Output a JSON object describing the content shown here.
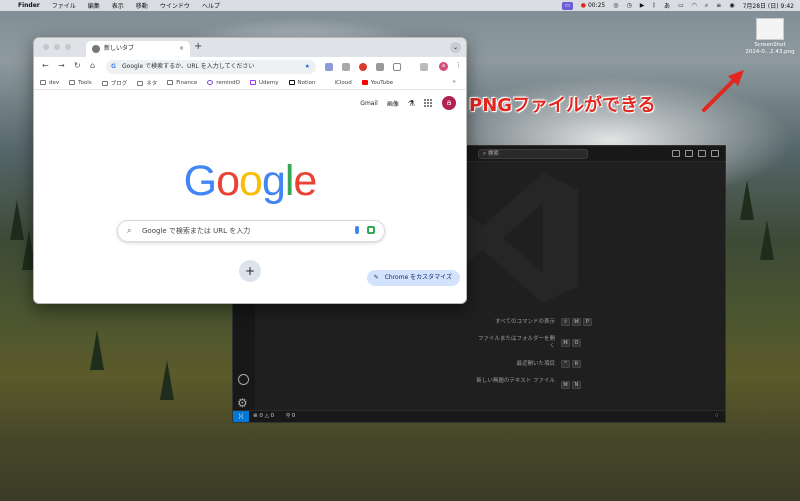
{
  "menubar": {
    "app_name": "Finder",
    "items": [
      "ファイル",
      "編集",
      "表示",
      "移動",
      "ウインドウ",
      "ヘルプ"
    ],
    "recording_time": "00:25",
    "input_method": "あ",
    "date_time": "7月28日 (日)  9:42"
  },
  "desktop_file": {
    "name_line1": "ScreenShot",
    "name_line2": "2024-0...2.43.png"
  },
  "annotation": {
    "text": "PNGファイルができる",
    "color": "#e3271e"
  },
  "chrome": {
    "tab_title": "新しいタブ",
    "omnibox_placeholder": "Google で検索するか、URL を入力してください",
    "avatar_letter": "a",
    "bookmarks": [
      "dev",
      "Tools",
      "ブログ",
      "ネタ",
      "Finance",
      "remindO",
      "Udemy",
      "Notion",
      "iCloud",
      "YouTube"
    ],
    "top_links": {
      "gmail": "Gmail",
      "images": "画像"
    },
    "profile_letter": "a",
    "logo_letters": [
      {
        "ch": "G",
        "color": "#4285f4"
      },
      {
        "ch": "o",
        "color": "#ea4335"
      },
      {
        "ch": "o",
        "color": "#fbbc05"
      },
      {
        "ch": "g",
        "color": "#4285f4"
      },
      {
        "ch": "l",
        "color": "#34a853"
      },
      {
        "ch": "e",
        "color": "#ea4335"
      }
    ],
    "search_placeholder": "Google で検索または URL を入力",
    "add_shortcut": "+",
    "customize_label": "Chrome をカスタマイズ"
  },
  "vscode": {
    "search_label": "検索",
    "commands": [
      {
        "label": "すべてのコマンドの表示",
        "keys": [
          "⇧",
          "⌘",
          "P"
        ]
      },
      {
        "label": "ファイルまたはフォルダーを開く",
        "keys": [
          "⌘",
          "O"
        ]
      },
      {
        "label": "最近開いた項目",
        "keys": [
          "^",
          "R"
        ]
      },
      {
        "label": "新しい無題のテキスト ファイル",
        "keys": [
          "⌘",
          "N"
        ]
      }
    ],
    "status_errors": "0",
    "status_warnings": "0",
    "status_ports": "0",
    "accent_color": "#0078d4"
  }
}
